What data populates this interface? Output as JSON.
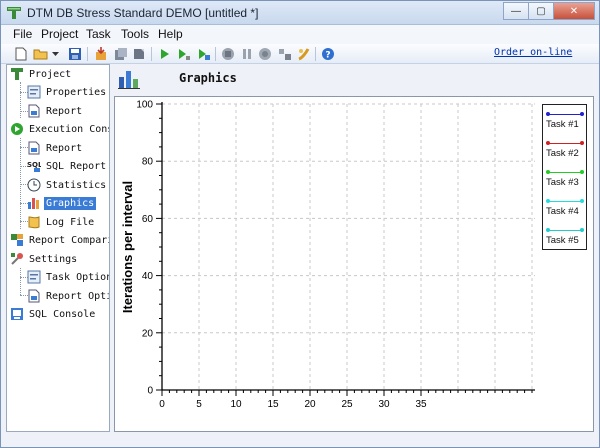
{
  "window": {
    "title": "DTM DB Stress Standard DEMO [untitled *]",
    "minimize_glyph": "—",
    "maximize_glyph": "▢",
    "close_glyph": "✕"
  },
  "menu": [
    "File",
    "Project",
    "Task",
    "Tools",
    "Help"
  ],
  "toolbar": {
    "buttons": [
      "new-file-icon",
      "open-folder-icon",
      "dropdown-arrow-icon",
      "save-icon",
      "import-icon",
      "export-icon",
      "run-icon",
      "run-step-icon",
      "run-selected-icon",
      "stop-icon",
      "pause-icon",
      "record-icon",
      "tasks-icon",
      "settings-icon",
      "help-icon"
    ],
    "order_link": "Order on-line"
  },
  "tree": [
    {
      "label": "Project",
      "icon": "project-icon"
    },
    {
      "label": "Properties",
      "icon": "properties-icon"
    },
    {
      "label": "Report",
      "icon": "report-icon"
    },
    {
      "label": "Execution Console",
      "icon": "execution-console-icon"
    },
    {
      "label": "Report",
      "icon": "report-icon"
    },
    {
      "label": "SQL Report",
      "icon": "sql-report-icon"
    },
    {
      "label": "Statistics",
      "icon": "statistics-icon"
    },
    {
      "label": "Graphics",
      "icon": "graphics-icon"
    },
    {
      "label": "Log File",
      "icon": "log-file-icon"
    },
    {
      "label": "Report Comparison",
      "icon": "report-comparison-icon"
    },
    {
      "label": "Settings",
      "icon": "settings-icon"
    },
    {
      "label": "Task Options",
      "icon": "task-options-icon"
    },
    {
      "label": "Report Options",
      "icon": "report-options-icon"
    },
    {
      "label": "SQL Console",
      "icon": "sql-console-icon"
    }
  ],
  "tree_selected": "Graphics",
  "page": {
    "title": "Graphics"
  },
  "chart_data": {
    "type": "line",
    "ylabel": "Iterations per interval",
    "xlabel": "",
    "xlim": [
      0,
      35
    ],
    "ylim": [
      0,
      100
    ],
    "x_ticks": [
      0,
      5,
      10,
      15,
      20,
      25,
      30,
      35
    ],
    "y_ticks": [
      0,
      20,
      40,
      60,
      80,
      100
    ],
    "grid": true,
    "legend_position": "top-right",
    "series": [
      {
        "name": "Task #1",
        "color": "#2222cc",
        "values": []
      },
      {
        "name": "Task #2",
        "color": "#cc2222",
        "values": []
      },
      {
        "name": "Task #3",
        "color": "#22cc22",
        "values": []
      },
      {
        "name": "Task #4",
        "color": "#22dddd",
        "values": []
      },
      {
        "name": "Task #5",
        "color": "#22cccc",
        "values": []
      }
    ]
  }
}
